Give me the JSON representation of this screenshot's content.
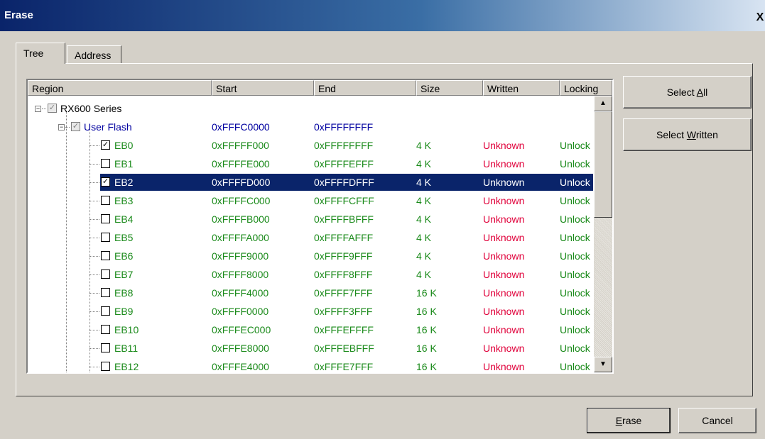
{
  "window": {
    "title": "Erase",
    "close_glyph": "X"
  },
  "tabs": [
    {
      "label": "Tree",
      "active": true
    },
    {
      "label": "Address",
      "active": false
    }
  ],
  "columns": [
    "Region",
    "Start",
    "End",
    "Size",
    "Written",
    "Locking"
  ],
  "tree": {
    "root": {
      "label": "RX600 Series",
      "expander": "−"
    },
    "group": {
      "label": "User Flash",
      "expander": "−",
      "start": "0xFFFC0000",
      "end": "0xFFFFFFFF"
    }
  },
  "rows": [
    {
      "name": "EB0",
      "checked": true,
      "start": "0xFFFFF000",
      "end": "0xFFFFFFFF",
      "size": "4 K",
      "written": "Unknown",
      "locking": "Unlock"
    },
    {
      "name": "EB1",
      "checked": false,
      "start": "0xFFFFE000",
      "end": "0xFFFFEFFF",
      "size": "4 K",
      "written": "Unknown",
      "locking": "Unlock"
    },
    {
      "name": "EB2",
      "checked": true,
      "start": "0xFFFFD000",
      "end": "0xFFFFDFFF",
      "size": "4 K",
      "written": "Unknown",
      "locking": "Unlock",
      "selected": true
    },
    {
      "name": "EB3",
      "checked": false,
      "start": "0xFFFFC000",
      "end": "0xFFFFCFFF",
      "size": "4 K",
      "written": "Unknown",
      "locking": "Unlock"
    },
    {
      "name": "EB4",
      "checked": false,
      "start": "0xFFFFB000",
      "end": "0xFFFFBFFF",
      "size": "4 K",
      "written": "Unknown",
      "locking": "Unlock"
    },
    {
      "name": "EB5",
      "checked": false,
      "start": "0xFFFFA000",
      "end": "0xFFFFAFFF",
      "size": "4 K",
      "written": "Unknown",
      "locking": "Unlock"
    },
    {
      "name": "EB6",
      "checked": false,
      "start": "0xFFFF9000",
      "end": "0xFFFF9FFF",
      "size": "4 K",
      "written": "Unknown",
      "locking": "Unlock"
    },
    {
      "name": "EB7",
      "checked": false,
      "start": "0xFFFF8000",
      "end": "0xFFFF8FFF",
      "size": "4 K",
      "written": "Unknown",
      "locking": "Unlock"
    },
    {
      "name": "EB8",
      "checked": false,
      "start": "0xFFFF4000",
      "end": "0xFFFF7FFF",
      "size": "16 K",
      "written": "Unknown",
      "locking": "Unlock"
    },
    {
      "name": "EB9",
      "checked": false,
      "start": "0xFFFF0000",
      "end": "0xFFFF3FFF",
      "size": "16 K",
      "written": "Unknown",
      "locking": "Unlock"
    },
    {
      "name": "EB10",
      "checked": false,
      "start": "0xFFFEC000",
      "end": "0xFFFEFFFF",
      "size": "16 K",
      "written": "Unknown",
      "locking": "Unlock"
    },
    {
      "name": "EB11",
      "checked": false,
      "start": "0xFFFE8000",
      "end": "0xFFFEBFFF",
      "size": "16 K",
      "written": "Unknown",
      "locking": "Unlock"
    },
    {
      "name": "EB12",
      "checked": false,
      "start": "0xFFFE4000",
      "end": "0xFFFE7FFF",
      "size": "16 K",
      "written": "Unknown",
      "locking": "Unlock"
    }
  ],
  "scrollbar": {
    "up_icon": "▲",
    "down_icon": "▼"
  },
  "buttons": {
    "select_all": {
      "pre": "Select ",
      "mnemonic": "A",
      "post": "ll"
    },
    "select_written": {
      "pre": "Select ",
      "mnemonic": "W",
      "post": "ritten"
    },
    "erase": {
      "pre": "",
      "mnemonic": "E",
      "post": "rase"
    },
    "cancel": {
      "label": "Cancel"
    }
  },
  "colors": {
    "row_text": "#1a8a1a",
    "group_text": "#0000a0",
    "written_text": "#e0003a",
    "selection": "#0a246a",
    "title_start": "#0a246a"
  }
}
